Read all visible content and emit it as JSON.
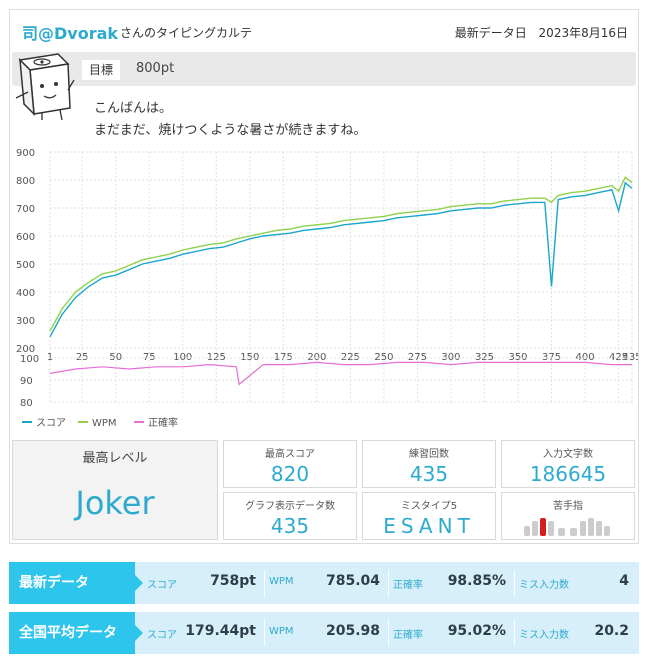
{
  "header": {
    "user": "司@Dvorak",
    "suffix": "さんのタイピングカルテ",
    "date_label": "最新データ日",
    "date": "2023年8月16日"
  },
  "goal": {
    "label": "目標",
    "value": "800pt"
  },
  "message": {
    "line1": "こんばんは。",
    "line2": "まだまだ、焼けつくような暑さが続きますね。"
  },
  "chart_data": [
    {
      "type": "line",
      "y_ticks": [
        "900",
        "800",
        "700",
        "600",
        "500",
        "400",
        "300",
        "200"
      ],
      "ylim": [
        200,
        900
      ],
      "x_ticks": [
        "1",
        "25",
        "50",
        "75",
        "100",
        "125",
        "150",
        "175",
        "200",
        "225",
        "250",
        "275",
        "300",
        "325",
        "350",
        "375",
        "400",
        "425",
        "435"
      ],
      "xlim": [
        1,
        435
      ],
      "legend": [
        "スコア",
        "WPM",
        "正確率"
      ],
      "colors": {
        "score": "#1aa6c9",
        "wpm": "#8fd14a",
        "acc": "#e86ed6"
      },
      "series": [
        {
          "name": "スコア",
          "x": [
            1,
            10,
            20,
            30,
            40,
            50,
            60,
            70,
            80,
            90,
            100,
            110,
            120,
            130,
            140,
            150,
            160,
            170,
            180,
            190,
            200,
            210,
            220,
            230,
            240,
            250,
            260,
            270,
            280,
            290,
            300,
            310,
            320,
            330,
            340,
            350,
            360,
            370,
            375,
            380,
            390,
            400,
            410,
            420,
            425,
            430,
            435
          ],
          "values": [
            240,
            320,
            380,
            420,
            450,
            460,
            480,
            500,
            510,
            520,
            535,
            545,
            555,
            560,
            575,
            590,
            600,
            605,
            610,
            620,
            625,
            630,
            640,
            645,
            650,
            655,
            665,
            670,
            675,
            680,
            690,
            695,
            700,
            700,
            710,
            715,
            720,
            720,
            420,
            730,
            740,
            745,
            755,
            765,
            690,
            790,
            770
          ]
        },
        {
          "name": "WPM",
          "x": [
            1,
            10,
            20,
            30,
            40,
            50,
            60,
            70,
            80,
            90,
            100,
            110,
            120,
            130,
            140,
            150,
            160,
            170,
            180,
            190,
            200,
            210,
            220,
            230,
            240,
            250,
            260,
            270,
            280,
            290,
            300,
            310,
            320,
            330,
            340,
            350,
            360,
            370,
            375,
            380,
            390,
            400,
            410,
            420,
            425,
            430,
            435
          ],
          "values": [
            260,
            340,
            400,
            435,
            465,
            475,
            495,
            515,
            525,
            535,
            550,
            560,
            570,
            575,
            590,
            600,
            610,
            620,
            625,
            635,
            640,
            645,
            655,
            660,
            665,
            670,
            680,
            685,
            690,
            695,
            705,
            710,
            715,
            715,
            725,
            730,
            735,
            735,
            720,
            745,
            755,
            760,
            770,
            780,
            760,
            810,
            790
          ]
        }
      ],
      "acc_ylim": [
        80,
        100
      ],
      "acc_y_ticks": [
        "100",
        "90",
        "80"
      ],
      "accuracy": {
        "name": "正確率",
        "x": [
          1,
          20,
          40,
          60,
          80,
          100,
          120,
          140,
          142,
          160,
          180,
          200,
          220,
          240,
          260,
          280,
          300,
          320,
          340,
          360,
          380,
          400,
          420,
          435
        ],
        "values": [
          93,
          95,
          96,
          95,
          96,
          96,
          97,
          96,
          88,
          97,
          97,
          98,
          97,
          97,
          98,
          98,
          97,
          98,
          98,
          98,
          98,
          98,
          97,
          97
        ]
      }
    }
  ],
  "stats": {
    "level": {
      "label": "最高レベル",
      "value": "Joker"
    },
    "items": [
      {
        "label": "最高スコア",
        "value": "820"
      },
      {
        "label": "練習回数",
        "value": "435"
      },
      {
        "label": "入力文字数",
        "value": "186645"
      },
      {
        "label": "グラフ表示データ数",
        "value": "435"
      },
      {
        "label": "ミスタイプ5",
        "value": "ESANT"
      },
      {
        "label": "苦手指",
        "value": ""
      }
    ]
  },
  "latest": {
    "title": "最新データ",
    "score_k": "スコア",
    "score": "758pt",
    "wpm_k": "WPM",
    "wpm": "785.04",
    "acc_k": "正確率",
    "acc": "98.85%",
    "miss_k": "ミス入力数",
    "miss": "4"
  },
  "national": {
    "title": "全国平均データ",
    "score_k": "スコア",
    "score": "179.44pt",
    "wpm_k": "WPM",
    "wpm": "205.98",
    "acc_k": "正確率",
    "acc": "95.02%",
    "miss_k": "ミス入力数",
    "miss": "20.2"
  }
}
